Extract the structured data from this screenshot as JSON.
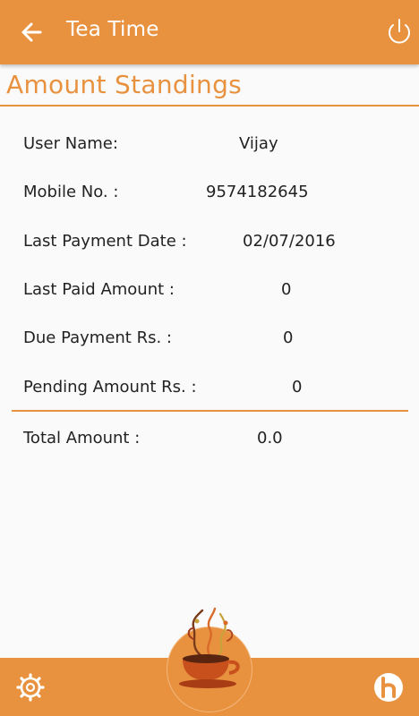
{
  "appbar": {
    "title": "Tea Time",
    "back_icon": "arrow-left-icon",
    "power_icon": "power-icon"
  },
  "page": {
    "title": "Amount Standings"
  },
  "details": {
    "user_name_label": "User Name:",
    "user_name_value": "Vijay",
    "mobile_label": "Mobile No. :",
    "mobile_value": "9574182645",
    "last_payment_date_label": "Last Payment Date :",
    "last_payment_date_value": "02/07/2016",
    "last_paid_amount_label": "Last Paid Amount :",
    "last_paid_amount_value": "0",
    "due_payment_label": "Due Payment Rs. :",
    "due_payment_value": "0",
    "pending_amount_label": "Pending Amount Rs. :",
    "pending_amount_value": "0",
    "total_amount_label": "Total Amount :",
    "total_amount_value": "0.0"
  },
  "bottombar": {
    "settings_icon": "gear-icon",
    "center_icon": "tea-cup-icon",
    "right_icon": "h-logo-icon"
  },
  "colors": {
    "accent": "#e89240",
    "background": "#fafafa",
    "text": "#222222"
  }
}
